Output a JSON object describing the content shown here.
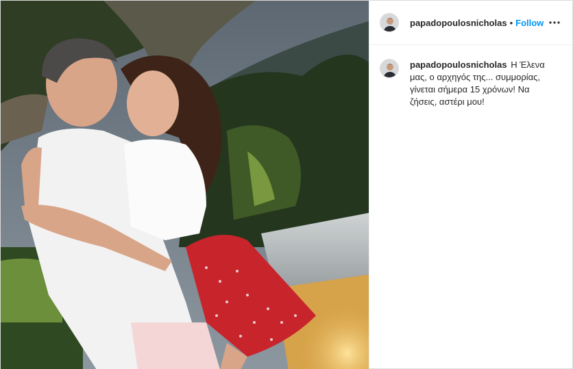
{
  "photo": {
    "alt_icon": "photo-image",
    "description_colors": {
      "sky": "#6f7b86",
      "foliage": "#2a3a22",
      "wall_light": "#f2c86a",
      "shirt": "#f4f4f4",
      "skirt": "#c8242c"
    }
  },
  "header": {
    "username": "papadopoulosnicholas",
    "separator": "•",
    "follow_label": "Follow",
    "more_icon": "more-options-icon"
  },
  "caption": {
    "username": "papadopoulosnicholas",
    "text": "Η Έλενα μας, ο αρχηγός της... συμμορίας, γίνεται σήμερα 15 χρόνων! Να ζήσεις, αστέρι μου!"
  },
  "colors": {
    "accent": "#0095f6",
    "text": "#262626",
    "border": "#dbdbdb"
  }
}
